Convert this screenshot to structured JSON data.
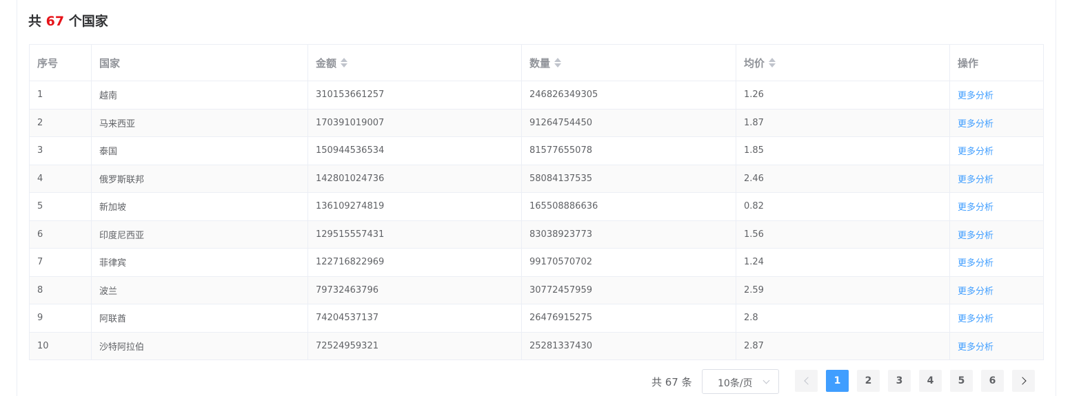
{
  "heading": {
    "prefix": "共",
    "count": "67",
    "suffix": "个国家"
  },
  "table": {
    "columns": [
      "序号",
      "国家",
      "金额",
      "数量",
      "均价",
      "操作"
    ],
    "rows": [
      {
        "idx": "1",
        "country": "越南",
        "amount": "310153661257",
        "qty": "246826349305",
        "avg": "1.26",
        "action": "更多分析"
      },
      {
        "idx": "2",
        "country": "马来西亚",
        "amount": "170391019007",
        "qty": "91264754450",
        "avg": "1.87",
        "action": "更多分析"
      },
      {
        "idx": "3",
        "country": "泰国",
        "amount": "150944536534",
        "qty": "81577655078",
        "avg": "1.85",
        "action": "更多分析"
      },
      {
        "idx": "4",
        "country": "俄罗斯联邦",
        "amount": "142801024736",
        "qty": "58084137535",
        "avg": "2.46",
        "action": "更多分析"
      },
      {
        "idx": "5",
        "country": "新加坡",
        "amount": "136109274819",
        "qty": "165508886636",
        "avg": "0.82",
        "action": "更多分析"
      },
      {
        "idx": "6",
        "country": "印度尼西亚",
        "amount": "129515557431",
        "qty": "83038923773",
        "avg": "1.56",
        "action": "更多分析"
      },
      {
        "idx": "7",
        "country": "菲律宾",
        "amount": "122716822969",
        "qty": "99170570702",
        "avg": "1.24",
        "action": "更多分析"
      },
      {
        "idx": "8",
        "country": "波兰",
        "amount": "79732463796",
        "qty": "30772457959",
        "avg": "2.59",
        "action": "更多分析"
      },
      {
        "idx": "9",
        "country": "阿联酋",
        "amount": "74204537137",
        "qty": "26476915275",
        "avg": "2.8",
        "action": "更多分析"
      },
      {
        "idx": "10",
        "country": "沙特阿拉伯",
        "amount": "72524959321",
        "qty": "25281337430",
        "avg": "2.87",
        "action": "更多分析"
      }
    ]
  },
  "pagination": {
    "total_text": "共 67 条",
    "page_size": "10条/页",
    "pages": [
      "1",
      "2",
      "3",
      "4",
      "5",
      "6"
    ],
    "current_page": "1"
  },
  "colors": {
    "accent": "#409eff",
    "count": "#e6141a"
  }
}
